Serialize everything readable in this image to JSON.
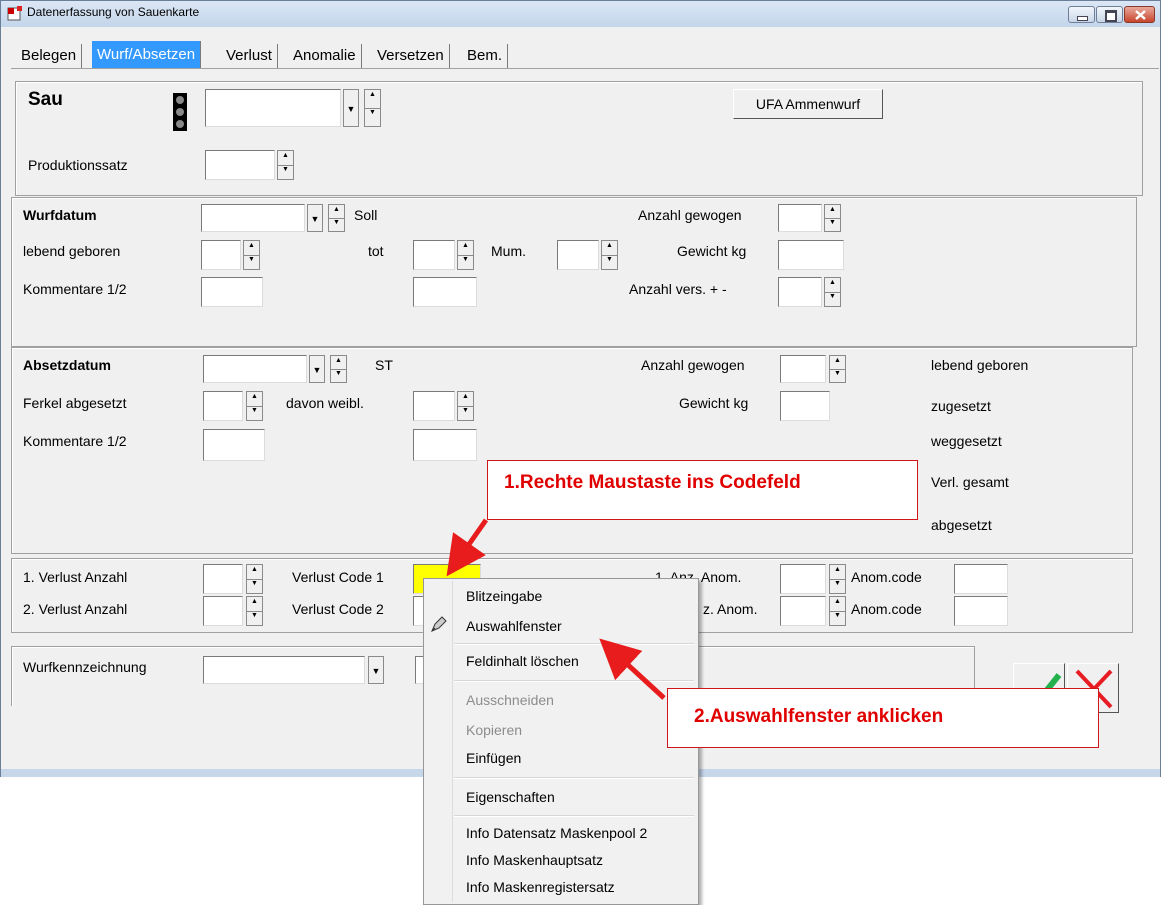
{
  "window": {
    "title": "Datenerfassung von Sauenkarte"
  },
  "tabs": [
    {
      "label": "Belegen"
    },
    {
      "label": "Wurf/Absetzen"
    },
    {
      "label": "Verlust"
    },
    {
      "label": "Anomalie"
    },
    {
      "label": "Versetzen"
    },
    {
      "label": "Bem."
    }
  ],
  "sau": {
    "label": "Sau",
    "produktionssatz": "Produktionssatz",
    "ufa_button": "UFA Ammenwurf"
  },
  "wurf": {
    "wurfdatum": "Wurfdatum",
    "soll": "Soll",
    "anzahl_gewogen": "Anzahl gewogen",
    "lebend_geboren": "lebend geboren",
    "tot": "tot",
    "mum": "Mum.",
    "gewicht": "Gewicht kg",
    "kommentare": "Kommentare 1/2",
    "anzahl_vers": "Anzahl vers. + -"
  },
  "absetz": {
    "absetzdatum": "Absetzdatum",
    "st": "ST",
    "anzahl_gewogen": "Anzahl gewogen",
    "lebend_geboren": "lebend geboren",
    "ferkel": "Ferkel abgesetzt",
    "davon": "davon weibl.",
    "gewicht": "Gewicht kg",
    "zugesetzt": "zugesetzt",
    "kommentare": "Kommentare 1/2",
    "weggesetzt": "weggesetzt",
    "verl_gesamt": "Verl. gesamt",
    "abgesetzt": "abgesetzt"
  },
  "verlust": {
    "v1": "1. Verlust  Anzahl",
    "v2": "2. Verlust  Anzahl",
    "code1": "Verlust Code 1",
    "code2": "Verlust Code 2",
    "anom1": "1. Anz. Anom.",
    "anom2": "z. Anom.",
    "anomcode1": "Anom.code",
    "anomcode2": "Anom.code"
  },
  "wurfkennzeichnung": "Wurfkennzeichnung",
  "context_menu": {
    "blitzeingabe": "Blitzeingabe",
    "auswahlfenster": "Auswahlfenster",
    "feldinhalt": "Feldinhalt löschen",
    "ausschneiden": "Ausschneiden",
    "kopieren": "Kopieren",
    "einfuegen": "Einfügen",
    "eigenschaften": "Eigenschaften",
    "info1": "Info Datensatz Maskenpool 2",
    "info2": "Info Maskenhauptsatz",
    "info3": "Info Maskenregistersatz"
  },
  "callouts": {
    "c1": "1.Rechte Maustaste ins Codefeld",
    "c2": "2.Auswahlfenster anklicken"
  },
  "colors": {
    "accent": "#3399ff",
    "highlight_field": "#ffff00",
    "annotation": "#e00000"
  }
}
